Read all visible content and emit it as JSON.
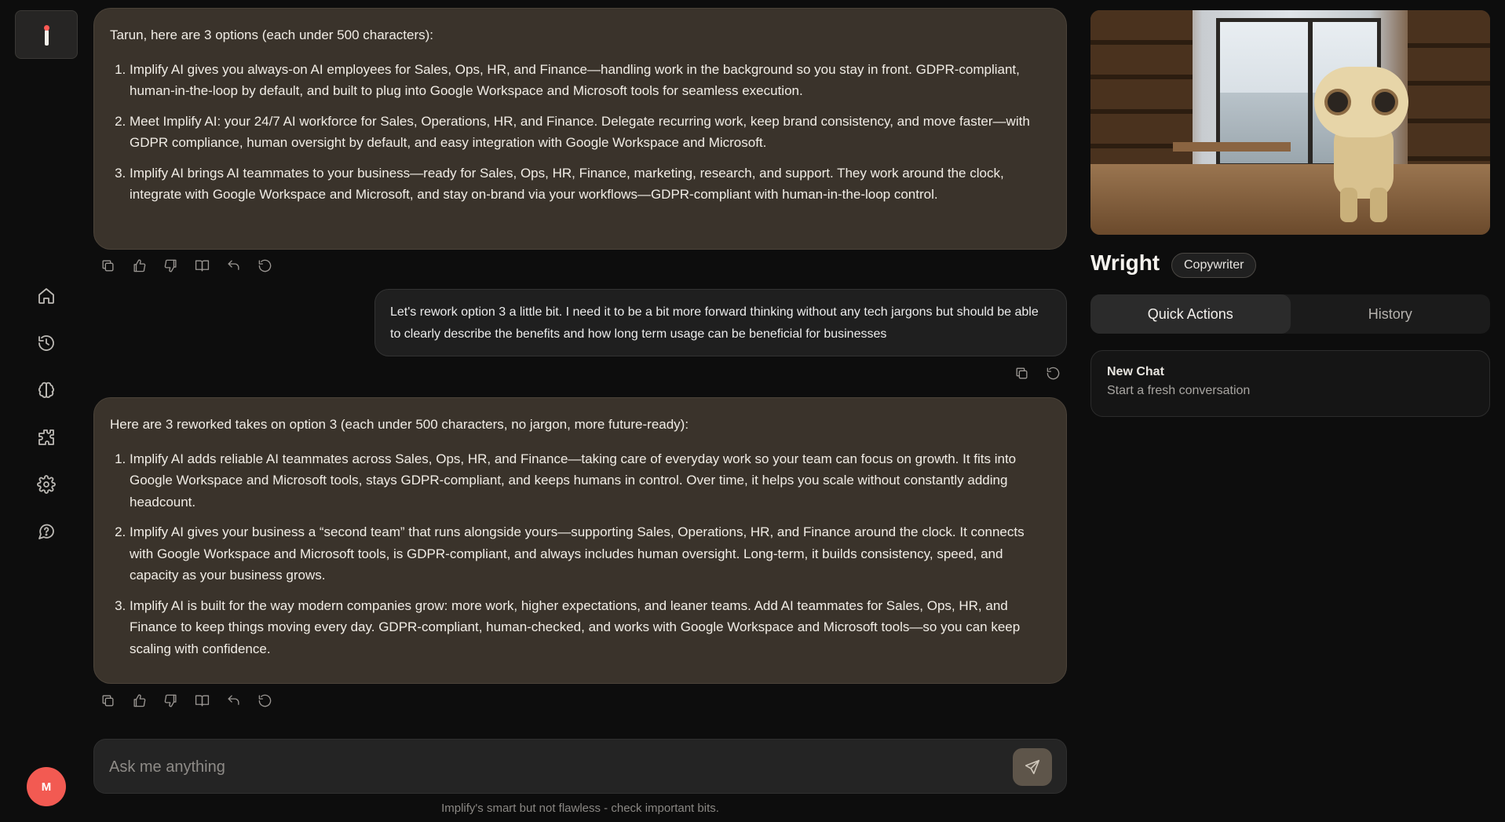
{
  "sidebar": {
    "nav": [
      "home-icon",
      "history-icon",
      "brain-icon",
      "puzzle-icon",
      "gear-icon",
      "help-icon"
    ],
    "avatar_initial": "M"
  },
  "messages": {
    "ai1": {
      "intro": "Tarun, here are 3 options (each under 500 characters):",
      "items": [
        "Implify AI gives you always-on AI employees for Sales, Ops, HR, and Finance—handling work in the background so you stay in front. GDPR-compliant, human-in-the-loop by default, and built to plug into Google Workspace and Microsoft tools for seamless execution.",
        "Meet Implify AI: your 24/7 AI workforce for Sales, Operations, HR, and Finance. Delegate recurring work, keep brand consistency, and move faster—with GDPR compliance, human oversight by default, and easy integration with Google Workspace and Microsoft.",
        "Implify AI brings AI teammates to your business—ready for Sales, Ops, HR, Finance, marketing, research, and support. They work around the clock, integrate with Google Workspace and Microsoft, and stay on-brand via your workflows—GDPR-compliant with human-in-the-loop control."
      ]
    },
    "user1": "Let's rework option 3 a little bit. I need it to be a bit more forward thinking without any tech jargons but should be able to clearly describe the benefits and how long term usage can be beneficial for businesses",
    "ai2": {
      "intro": "Here are 3 reworked takes on option 3 (each under 500 characters, no jargon, more future-ready):",
      "items": [
        "Implify AI adds reliable AI teammates across Sales, Ops, HR, and Finance—taking care of everyday work so your team can focus on growth. It fits into Google Workspace and Microsoft tools, stays GDPR-compliant, and keeps humans in control. Over time, it helps you scale without constantly adding headcount.",
        "Implify AI gives your business a “second team” that runs alongside yours—supporting Sales, Operations, HR, and Finance around the clock. It connects with Google Workspace and Microsoft tools, is GDPR-compliant, and always includes human oversight. Long-term, it builds consistency, speed, and capacity as your business grows.",
        "Implify AI is built for the way modern companies grow: more work, higher expectations, and leaner teams. Add AI teammates for Sales, Ops, HR, and Finance to keep things moving every day. GDPR-compliant, human-checked, and works with Google Workspace and Microsoft tools—so you can keep scaling with confidence."
      ]
    }
  },
  "composer": {
    "placeholder": "Ask me anything",
    "disclaimer": "Implify's smart but not flawless - check important bits."
  },
  "agent": {
    "name": "Wright",
    "role": "Copywriter",
    "tabs": [
      "Quick Actions",
      "History"
    ],
    "active_tab": "Quick Actions",
    "quick_actions": [
      {
        "title": "New Chat",
        "subtitle": "Start a fresh conversation"
      }
    ]
  },
  "colors": {
    "background": "#0d0d0d",
    "ai_bubble": "#3a332b",
    "avatar": "#f25a52",
    "logo_dot": "#ff5a55"
  }
}
